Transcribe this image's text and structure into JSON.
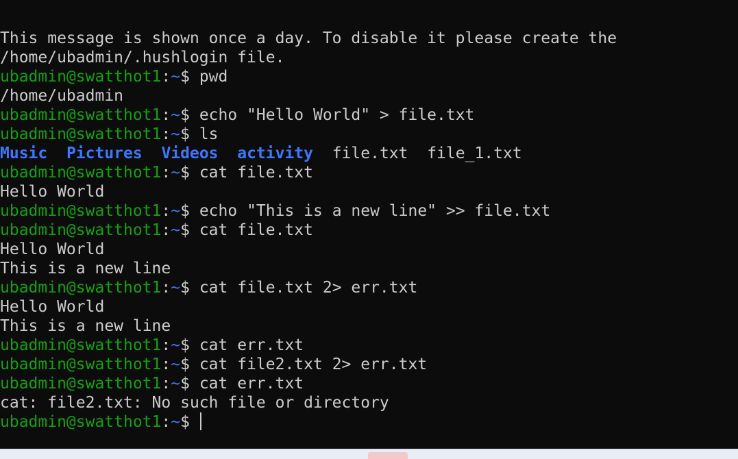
{
  "terminal": {
    "prompt": {
      "user_host": "ubadmin@swatthot1",
      "separator": ":",
      "path": "~",
      "symbol": "$ "
    },
    "lines": [
      {
        "text": "This message is shown once a day. To disable it please create the"
      },
      {
        "text": "/home/ubadmin/.hushlogin file."
      },
      {
        "command": "pwd"
      },
      {
        "text": "/home/ubadmin"
      },
      {
        "command": "echo \"Hello World\" > file.txt"
      },
      {
        "command": "ls"
      },
      {
        "ls": {
          "dirs": [
            "Music",
            "Pictures",
            "Videos",
            "activity"
          ],
          "files": [
            "file.txt",
            "file_1.txt"
          ]
        }
      },
      {
        "command": "cat file.txt"
      },
      {
        "text": "Hello World"
      },
      {
        "command": "echo \"This is a new line\" >> file.txt"
      },
      {
        "command": "cat file.txt"
      },
      {
        "text": "Hello World"
      },
      {
        "text": "This is a new line"
      },
      {
        "command": "cat file.txt 2> err.txt"
      },
      {
        "text": "Hello World"
      },
      {
        "text": "This is a new line"
      },
      {
        "command": "cat err.txt"
      },
      {
        "command": "cat file2.txt 2> err.txt"
      },
      {
        "command": "cat err.txt"
      },
      {
        "text": "cat: file2.txt: No such file or directory"
      },
      {
        "command": "",
        "active": true
      }
    ]
  },
  "colors": {
    "background": "#0c0c0c",
    "foreground": "#cccccc",
    "prompt_user": "#13a10e",
    "prompt_path": "#3b78ff",
    "directory": "#3b78ff"
  }
}
